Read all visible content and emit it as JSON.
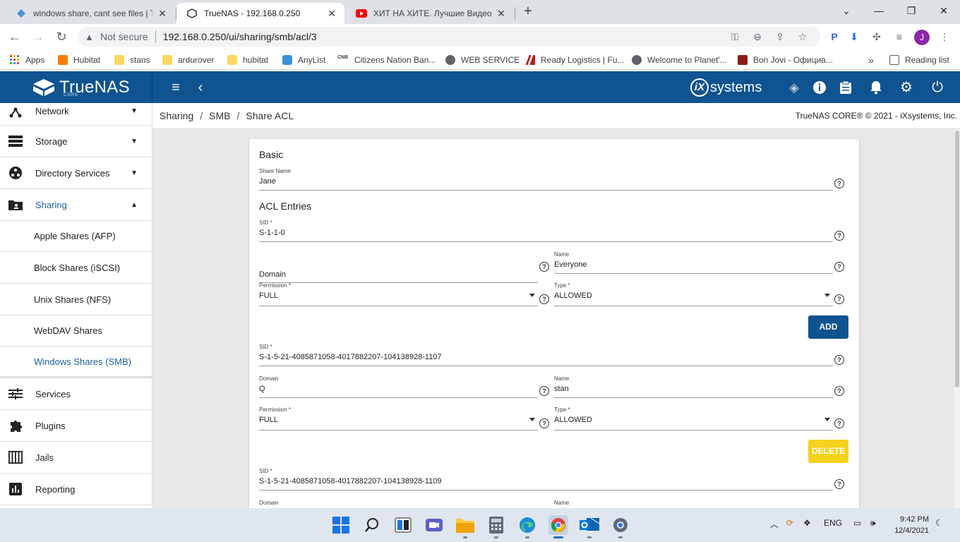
{
  "browser": {
    "tabs": [
      {
        "title": "windows share, cant see files | Tr",
        "active": false
      },
      {
        "title": "TrueNAS - 192.168.0.250",
        "active": true
      },
      {
        "title": "ХИТ НА ХИТЕ. Лучшие Видео К",
        "active": false
      }
    ],
    "new_tab": "+",
    "security_label": "Not secure",
    "url": "192.168.0.250/ui/sharing/smb/acl/3",
    "profile_initial": "J",
    "bookmarks": [
      "Apps",
      "Hubitat",
      "stans",
      "ardurover",
      "hubitat",
      "AnyList",
      "Citizens Nation Ban...",
      "WEB SERVICE",
      "Ready Logistics | Fu...",
      "Welcome to Planet'...",
      "Bon Jovi - Официа..."
    ],
    "bookmarks_overflow": "»",
    "reading_list": "Reading list"
  },
  "header": {
    "logo": "TrueNAS",
    "logo_sub": "CORE",
    "vendor_ix": "iX",
    "vendor": "systems"
  },
  "sidebar": {
    "items": [
      {
        "label": "Network",
        "icon": "network-icon",
        "caret": "▼"
      },
      {
        "label": "Storage",
        "icon": "storage-icon",
        "caret": "▼"
      },
      {
        "label": "Directory Services",
        "icon": "directory-services-icon",
        "caret": "▼"
      },
      {
        "label": "Sharing",
        "icon": "sharing-icon",
        "caret": "▲"
      },
      {
        "label": "Apple Shares (AFP)"
      },
      {
        "label": "Block Shares (iSCSI)"
      },
      {
        "label": "Unix Shares (NFS)"
      },
      {
        "label": "WebDAV Shares"
      },
      {
        "label": "Windows Shares (SMB)"
      },
      {
        "label": "Services",
        "icon": "services-icon"
      },
      {
        "label": "Plugins",
        "icon": "plugins-icon"
      },
      {
        "label": "Jails",
        "icon": "jails-icon"
      },
      {
        "label": "Reporting",
        "icon": "reporting-icon"
      }
    ]
  },
  "breadcrumb": [
    "Sharing",
    "SMB",
    "Share ACL"
  ],
  "breadcrumb_sep": "/",
  "copyright": "TrueNAS CORE® © 2021 - iXsystems, Inc.",
  "form": {
    "basic_title": "Basic",
    "share_name_label": "Share Name",
    "share_name": "Jane",
    "acl_title": "ACL Entries",
    "help_glyph": "?",
    "sid_label": "SID *",
    "domain_label": "Domain",
    "name_label": "Name",
    "permission_label": "Permission *",
    "type_label": "Type *",
    "add_label": "ADD",
    "delete_label": "DELETE",
    "entries": [
      {
        "sid": "S-1-1-0",
        "domain": "",
        "name": "Everyone",
        "permission": "FULL",
        "type": "ALLOWED"
      },
      {
        "sid": "S-1-5-21-4085871058-4017882207-104138928-1107",
        "domain": "Q",
        "name": "stan",
        "permission": "FULL",
        "type": "ALLOWED"
      },
      {
        "sid": "S-1-5-21-4085871058-4017882207-104138928-1109"
      }
    ]
  },
  "taskbar": {
    "lang": "ENG",
    "time": "9:42 PM",
    "date": "12/4/2021"
  }
}
